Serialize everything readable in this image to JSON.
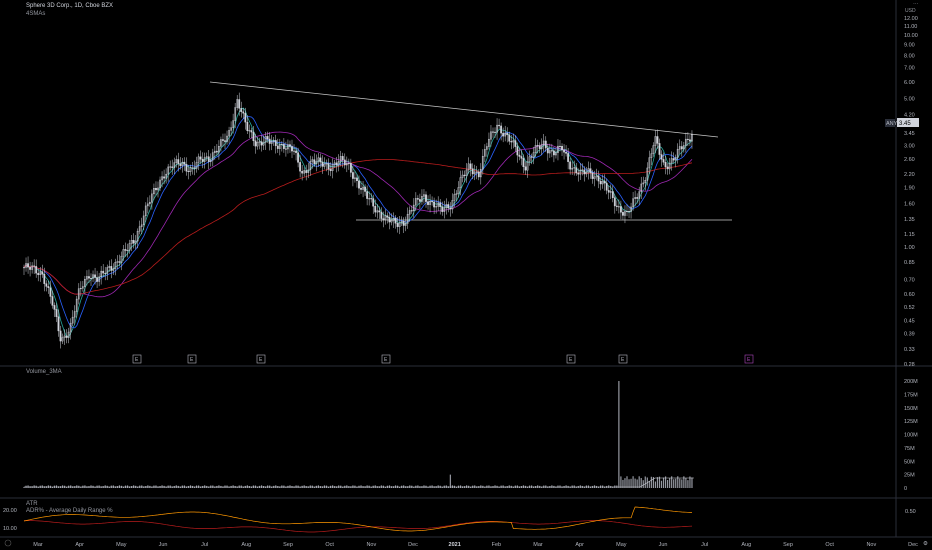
{
  "header": {
    "title": "Sphere 3D Corp., 1D, Cboe BZX",
    "indicator": "4SMAs",
    "currency": "USD",
    "price_tag": "3.45",
    "symbol_tag": "ANY"
  },
  "volume_pane": {
    "label": "Volume_3MA"
  },
  "atr_pane": {
    "label1": "ATR",
    "label2": "ADR% - Average Daily Range %"
  },
  "colors": {
    "background": "#000000",
    "candle": "#d1d4dc",
    "trendline": "#c8c8c8",
    "sma_fast": "#26a69a",
    "sma_med": "#2962ff",
    "sma_slow": "#9c27b0",
    "sma_long": "#b71c1c",
    "atr": "#ff9800",
    "adr": "#b71c1c",
    "earnings_future": "#ab47bc"
  },
  "chart_data": {
    "type": "candlestick",
    "price_axis_ticks": [
      "12.00",
      "11.00",
      "10.00",
      "9.00",
      "8.00",
      "7.00",
      "6.00",
      "5.00",
      "4.20",
      "3.45",
      "3.00",
      "2.60",
      "2.20",
      "1.90",
      "1.60",
      "1.35",
      "1.15",
      "1.00",
      "0.85",
      "0.70",
      "0.60",
      "0.52",
      "0.45",
      "0.39",
      "0.33",
      "0.28"
    ],
    "y_scale": "log",
    "time_axis_ticks": [
      "Mar",
      "Apr",
      "May",
      "Jun",
      "Jul",
      "Aug",
      "Sep",
      "Oct",
      "Nov",
      "Dec",
      "2021",
      "Feb",
      "Mar",
      "Apr",
      "May",
      "Jun",
      "Jul",
      "Aug",
      "Sep",
      "Oct",
      "Nov",
      "Dec"
    ],
    "price_path": [
      [
        "Mar",
        0.8
      ],
      [
        "Mar",
        0.78
      ],
      [
        "Mar",
        0.75
      ],
      [
        "Mar",
        0.55
      ],
      [
        "Mar",
        0.36
      ],
      [
        "Apr",
        0.42
      ],
      [
        "Apr",
        0.62
      ],
      [
        "Apr",
        0.75
      ],
      [
        "Apr",
        0.7
      ],
      [
        "Apr",
        0.78
      ],
      [
        "Apr",
        0.85
      ],
      [
        "May",
        0.95
      ],
      [
        "May",
        1.1
      ],
      [
        "May",
        1.45
      ],
      [
        "May",
        1.8
      ],
      [
        "May",
        2.2
      ],
      [
        "Jun",
        2.4
      ],
      [
        "Jun",
        2.5
      ],
      [
        "Jun",
        2.3
      ],
      [
        "Jun",
        2.55
      ],
      [
        "Jun",
        2.65
      ],
      [
        "Jul",
        2.95
      ],
      [
        "Jul",
        3.3
      ],
      [
        "Jul",
        5.0
      ],
      [
        "Jul",
        3.6
      ],
      [
        "Jul",
        3.1
      ],
      [
        "Aug",
        3.2
      ],
      [
        "Aug",
        3.0
      ],
      [
        "Aug",
        3.05
      ],
      [
        "Aug",
        2.85
      ],
      [
        "Sep",
        2.2
      ],
      [
        "Sep",
        2.55
      ],
      [
        "Sep",
        2.45
      ],
      [
        "Sep",
        2.4
      ],
      [
        "Oct",
        2.55
      ],
      [
        "Oct",
        2.4
      ],
      [
        "Oct",
        2.0
      ],
      [
        "Oct",
        1.7
      ],
      [
        "Nov",
        1.5
      ],
      [
        "Nov",
        1.35
      ],
      [
        "Nov",
        1.28
      ],
      [
        "Nov",
        1.32
      ],
      [
        "Dec",
        1.55
      ],
      [
        "Dec",
        1.75
      ],
      [
        "Dec",
        1.6
      ],
      [
        "Dec",
        1.48
      ],
      [
        "2021",
        1.6
      ],
      [
        "2021",
        2.0
      ],
      [
        "2021",
        2.4
      ],
      [
        "2021",
        2.2
      ],
      [
        "Feb",
        3.1
      ],
      [
        "Feb",
        3.8
      ],
      [
        "Feb",
        3.3
      ],
      [
        "Feb",
        2.9
      ],
      [
        "Mar",
        2.4
      ],
      [
        "Mar",
        2.8
      ],
      [
        "Mar",
        3.1
      ],
      [
        "Mar",
        2.75
      ],
      [
        "Apr",
        2.9
      ],
      [
        "Apr",
        2.4
      ],
      [
        "Apr",
        2.2
      ],
      [
        "Apr",
        2.25
      ],
      [
        "May",
        2.1
      ],
      [
        "May",
        1.8
      ],
      [
        "May",
        1.55
      ],
      [
        "May",
        1.42
      ],
      [
        "Jun",
        1.7
      ],
      [
        "Jun",
        2.2
      ],
      [
        "Jun",
        3.2
      ],
      [
        "Jun",
        2.4
      ],
      [
        "Jul",
        2.6
      ],
      [
        "Jul",
        2.95
      ],
      [
        "Jul",
        3.45
      ]
    ],
    "volume_axis_ticks": [
      "200M",
      "175M",
      "150M",
      "125M",
      "100M",
      "75M",
      "50M",
      "25M",
      "0"
    ],
    "atr_axis_left": [
      "20.00",
      "10.00"
    ],
    "atr_axis_right": [
      "0.50"
    ]
  }
}
